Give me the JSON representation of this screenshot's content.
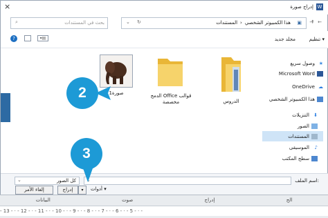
{
  "dialog": {
    "title": "إدراج صورة",
    "close": "×"
  },
  "address": {
    "breadcrumb": [
      "هذا الكمبيوتر الشخصي",
      "المستندات"
    ],
    "search_placeholder": "بحث في المستندات"
  },
  "toolbar": {
    "organize": "تنظيم",
    "new_folder": "مجلد جديد"
  },
  "sidebar": {
    "items": [
      "وصول سريع",
      "Microsoft Word",
      "OneDrive",
      "هذا الكمبيوتر الشخصي",
      "التنزيلات",
      "الصور",
      "المستندات",
      "الموسيقى",
      "سطح المكتب"
    ]
  },
  "files": [
    {
      "name": "الدروس",
      "type": "folder"
    },
    {
      "name": "الدمج Office قوالب مخصصة",
      "type": "folder"
    },
    {
      "name": "صورة1",
      "type": "image"
    }
  ],
  "bottom": {
    "filename_label": "اسم الملف:",
    "filetype_value": "كل الصور",
    "tools_label": "أدوات",
    "insert_button": "إدراج",
    "cancel_button": "إلغاء الأمر"
  },
  "ruler": {
    "ticks": "- 13 - · - 12 - · - 11 - · - 10 - · - 9 - · - 8 - · - 7 - · - 6 - · - 5 - · -",
    "row_labels": [
      "البيانات",
      "صوت",
      "إدراج",
      "الح"
    ]
  },
  "badges": [
    "2",
    "3"
  ],
  "colors": {
    "accent": "#1d9ad6",
    "folder": "#f3c54a"
  }
}
